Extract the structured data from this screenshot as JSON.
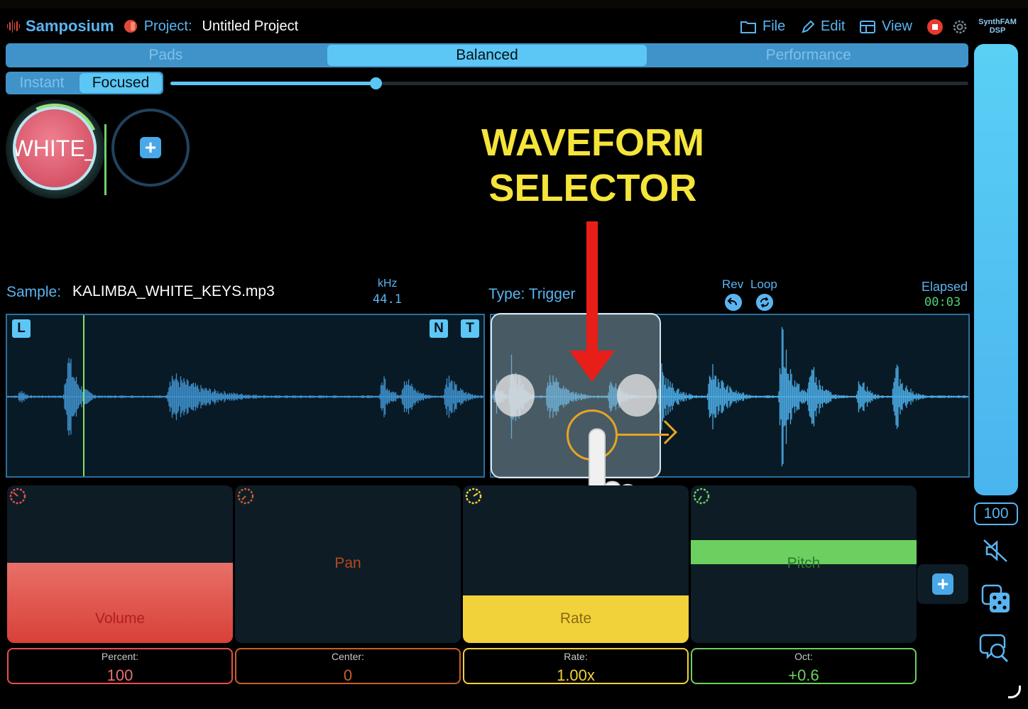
{
  "header": {
    "app_name": "Samposium",
    "project_label": "Project:",
    "project_name": "Untitled Project",
    "menu": {
      "file": "File",
      "edit": "Edit",
      "view": "View"
    },
    "dsp_logo": [
      "SynthFAM",
      "DSP"
    ]
  },
  "mode_tabs": [
    "Pads",
    "Balanced",
    "Performance"
  ],
  "active_mode": "Balanced",
  "sub_tabs": [
    "Instant",
    "Focused"
  ],
  "active_sub_tab": "Focused",
  "focus_slider": {
    "value": 0.26
  },
  "pads": [
    {
      "label": "WHITE_",
      "color": "#d65468"
    }
  ],
  "annotation": {
    "line1": "WAVEFORM",
    "line2": "SELECTOR"
  },
  "sample": {
    "label": "Sample:",
    "file": "KALIMBA_WHITE_KEYS.mp3",
    "khz_label": "kHz",
    "khz_value": "44.1",
    "type": "Type: Trigger",
    "rev": "Rev",
    "loop": "Loop",
    "elapsed_label": "Elapsed",
    "elapsed_value": "00:03"
  },
  "waveform_badges": [
    "L",
    "N",
    "T"
  ],
  "params": [
    {
      "name": "Volume",
      "value_label": "Percent:",
      "value": "100",
      "color": "#e8504a",
      "text_color": "#b0201c",
      "level": 0.51
    },
    {
      "name": "Pan",
      "value_label": "Center:",
      "value": "0",
      "color": "#c8602a",
      "text_color": "#b8481a",
      "level": 0.0
    },
    {
      "name": "Rate",
      "value_label": "Rate:",
      "value": "1.00x",
      "color": "#f2d23a",
      "text_color": "#8a6a10",
      "level": 0.3
    },
    {
      "name": "Pitch",
      "value_label": "Oct:",
      "value": "+0.6",
      "color": "#6cd060",
      "text_color": "#2a7a2a",
      "level": 0.8
    }
  ],
  "master": {
    "value": "100"
  },
  "colors": {
    "accent": "#5ab4f0",
    "tab_active": "#5cc7f5",
    "record": "#e63b2e",
    "annotation": "#f5e43a",
    "arrow": "#e81f18"
  }
}
